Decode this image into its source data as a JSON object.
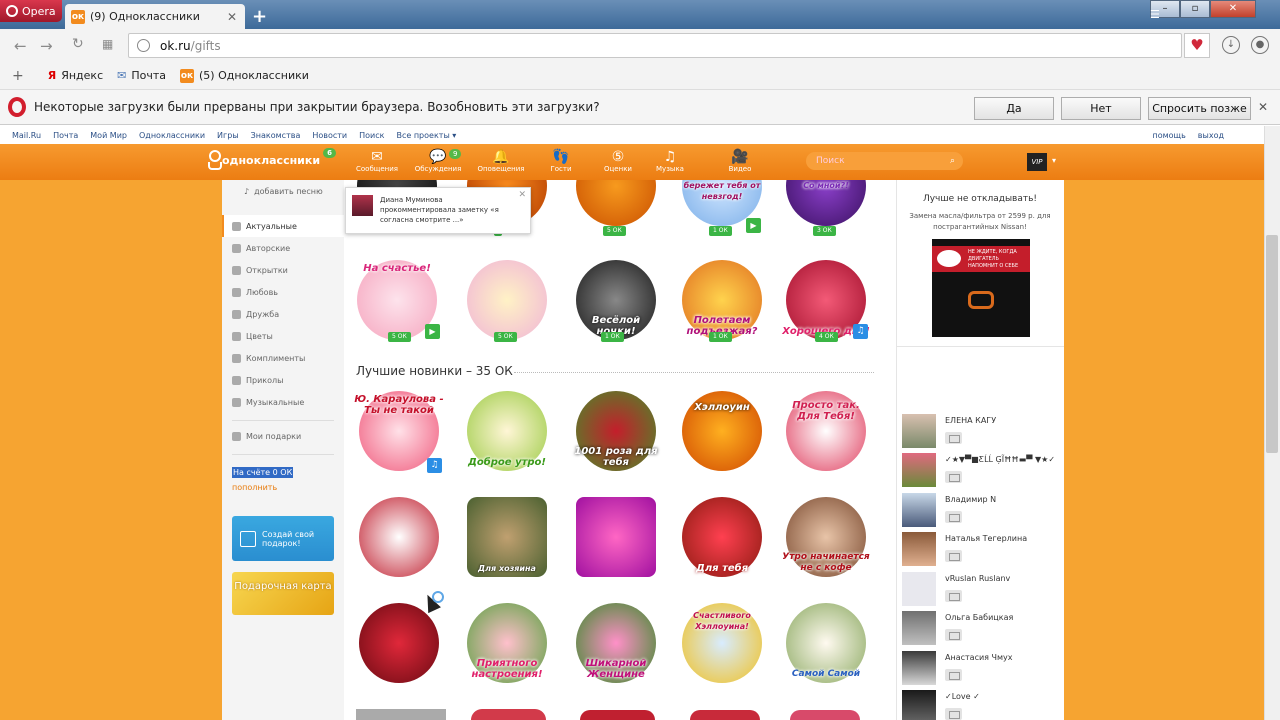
{
  "browser": {
    "menu_label": "Opera",
    "tab_title": "(9) Одноклассники",
    "tab_close": "✕",
    "new_tab": "+",
    "url_host": "ok.ru",
    "url_path": "/gifts",
    "bookmarks": [
      {
        "label": "Яндекс",
        "icon": "yandex-icon"
      },
      {
        "label": "Почта",
        "icon": "mail-icon"
      },
      {
        "label": "(5) Одноклассники",
        "icon": "ok-icon"
      }
    ],
    "notification": {
      "text": "Некоторые загрузки были прерваны при закрытии браузера. Возобновить эти загрузки?",
      "yes": "Да",
      "no": "Нет",
      "later": "Спросить позже"
    }
  },
  "portal": {
    "links": [
      "Mail.Ru",
      "Почта",
      "Мой Мир",
      "Одноклассники",
      "Игры",
      "Знакомства",
      "Новости",
      "Поиск",
      "Все проекты ▾"
    ],
    "help": "помощь",
    "logout": "выход"
  },
  "header": {
    "logo": "одноклассники",
    "logo_badge": "6",
    "nav": [
      {
        "label": "Сообщения",
        "icon": "envelope-icon",
        "glyph": "✉",
        "badge": ""
      },
      {
        "label": "Обсуждения",
        "icon": "chat-icon",
        "glyph": "💬",
        "badge": "9"
      },
      {
        "label": "Оповещения",
        "icon": "bell-icon",
        "glyph": "🔔",
        "badge": ""
      },
      {
        "label": "Гости",
        "icon": "footprints-icon",
        "glyph": "👣",
        "badge": ""
      },
      {
        "label": "Оценки",
        "icon": "rating-icon",
        "glyph": "⑤",
        "badge": ""
      },
      {
        "label": "Музыка",
        "icon": "music-icon",
        "glyph": "♫",
        "badge": ""
      },
      {
        "label": "Видео",
        "icon": "video-icon",
        "glyph": "🎥",
        "badge": ""
      }
    ],
    "search_placeholder": "Поиск",
    "vip": "VIP",
    "colors": {
      "orange": "#ec7d12",
      "green": "#54b847"
    }
  },
  "left": {
    "add_song": "добавить песню",
    "categories": [
      "Актуальные",
      "Авторские",
      "Открытки",
      "Любовь",
      "Дружба",
      "Цветы",
      "Комплименты",
      "Приколы",
      "Музыкальные"
    ],
    "my_gifts": "Мои подарки",
    "balance": "На счёте 0 ОК",
    "topup": "пополнить",
    "promo_create": "Создай свой подарок!",
    "promo_card": "Подарочная карта"
  },
  "popup": {
    "name": "Диана Муминова",
    "text": "прокомментировала заметку «я согласна смотрите ...»",
    "close": "✕"
  },
  "gifts": {
    "top_row": [
      {
        "caption": "",
        "price": ""
      },
      {
        "caption": "",
        "price": ""
      },
      {
        "caption": "",
        "price": "5 ОК"
      },
      {
        "caption": "бережет тебя от невзгод!",
        "price": "1 ОК"
      },
      {
        "caption": "Со мной?!",
        "price": "3 ОК"
      }
    ],
    "row2": [
      {
        "caption": "На счастье!",
        "price": "5 ОК"
      },
      {
        "caption": "",
        "price": "5 ОК"
      },
      {
        "caption": "Весёлой ночки!",
        "price": "1 ОК"
      },
      {
        "caption": "Полетаем подъезжая?",
        "price": "1 ОК"
      },
      {
        "caption": "Хорошего дня!",
        "price": "4 ОК"
      }
    ],
    "section_title": "Лучшие новинки – 35 ОК",
    "new_items": [
      {
        "caption": "Ю. Караулова - Ты не такой"
      },
      {
        "caption": "Доброе утро!"
      },
      {
        "caption": "1001 роза для тебя"
      },
      {
        "caption": "Хэллоуин"
      },
      {
        "caption": "Просто так. Для Тебя!"
      },
      {
        "caption": ""
      },
      {
        "caption": "Для хозяина"
      },
      {
        "caption": ""
      },
      {
        "caption": "Для тебя"
      },
      {
        "caption": "Утро начинается не с кофе"
      },
      {
        "caption": ""
      },
      {
        "caption": "Приятного настроения!"
      },
      {
        "caption": "Шикарной Женщине"
      },
      {
        "caption": "Счастливого Хэллоуина!"
      },
      {
        "caption": "Самой Самой"
      }
    ]
  },
  "right": {
    "ad_title": "Лучше не откладывать!",
    "ad_text": "Замена масла/фильтра от 2599 р. для пострагантийных Nissan!",
    "ad_banner": "НЕ ЖДИТЕ, КОГДА ДВИГАТЕЛЬ НАПОМНИТ О СЕБЕ",
    "friends": [
      {
        "name": "ЕЛЕНА КАГУ"
      },
      {
        "name": "✓★▼▀■ƸĹĹ ĢĨĦĦ▬▀ ▼★✓"
      },
      {
        "name": "Владимир N"
      },
      {
        "name": "Наталья Тегерлина"
      },
      {
        "name": "vRuslan Ruslanv"
      },
      {
        "name": "Ольга Бабицкая"
      },
      {
        "name": "Анастасия Чмух"
      },
      {
        "name": "✓Love ✓"
      }
    ]
  }
}
